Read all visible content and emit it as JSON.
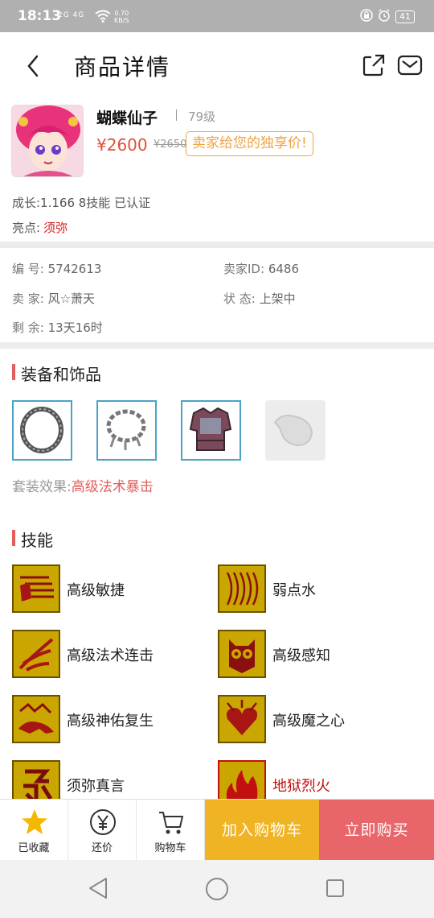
{
  "status_bar": {
    "time": "18:13",
    "signal": "2G 4G",
    "net_speed": "0.70",
    "net_unit": "KB/S",
    "battery": "41"
  },
  "header": {
    "title": "商品详情"
  },
  "role": {
    "name": "蝴蝶仙子",
    "level": "79级",
    "price": "¥2600",
    "old_price": "¥2650",
    "promo": "卖家给您的独享价!",
    "growth": "成长:1.166 8技能 已认证",
    "highlight_label": "亮点:",
    "highlight_value": "须弥"
  },
  "info": {
    "id_label": "编  号:",
    "id_value": "5742613",
    "seller_id_label": "卖家ID:",
    "seller_id_value": "6486",
    "seller_label": "卖  家:",
    "seller_value": "风☆萧天",
    "status_label": "状  态:",
    "status_value": "上架中",
    "remain_label": "剩  余:",
    "remain_value": "13天16时"
  },
  "equipment": {
    "title": "装备和饰品",
    "set_label": "套装效果:",
    "set_value": "高级法术暴击"
  },
  "skills": {
    "title": "技能",
    "items": [
      {
        "name": "高级敏捷",
        "icon": "running-feet-icon"
      },
      {
        "name": "弱点水",
        "icon": "water-wave-icon"
      },
      {
        "name": "高级法术连击",
        "icon": "claw-strike-icon"
      },
      {
        "name": "高级感知",
        "icon": "owl-icon"
      },
      {
        "name": "高级神佑复生",
        "icon": "beast-revive-icon"
      },
      {
        "name": "高级魔之心",
        "icon": "heart-icon"
      },
      {
        "name": "须弥真言",
        "icon": "glyph-icon"
      },
      {
        "name": "地狱烈火",
        "icon": "flame-icon"
      }
    ]
  },
  "bottom_bar": {
    "favorite": "已收藏",
    "bargain": "还价",
    "cart": "购物车",
    "add_cart": "加入购物车",
    "buy_now": "立即购买"
  },
  "colors": {
    "accent_red": "#e35d5d",
    "price_red": "#e04f3a",
    "cart_yellow": "#f0b323",
    "buy_red": "#e8666a",
    "promo_orange": "#f0a340"
  }
}
